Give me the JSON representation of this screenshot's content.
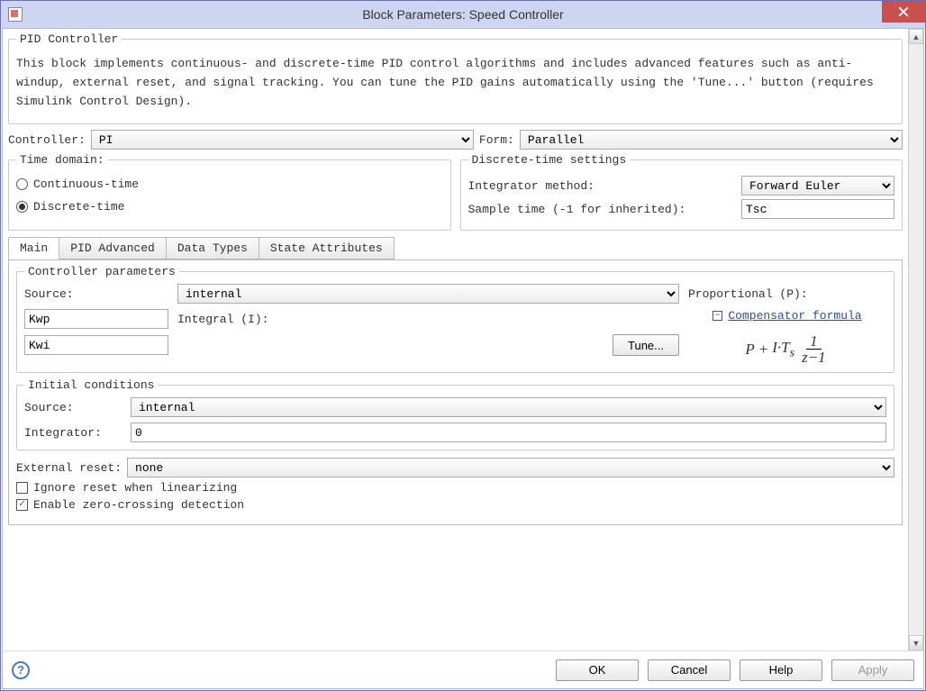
{
  "window": {
    "title": "Block Parameters: Speed Controller"
  },
  "pid_group": {
    "legend": "PID Controller",
    "description": "This block implements continuous- and discrete-time PID control algorithms and includes advanced features such as anti-windup, external reset, and signal tracking. You can tune the PID gains automatically using the 'Tune...' button (requires Simulink Control Design)."
  },
  "controller_row": {
    "label": "Controller:",
    "value": "PI"
  },
  "form_row": {
    "label": "Form:",
    "value": "Parallel"
  },
  "time_domain": {
    "legend": "Time domain:",
    "options": {
      "continuous": "Continuous-time",
      "discrete": "Discrete-time"
    },
    "selected": "discrete"
  },
  "discrete_settings": {
    "legend": "Discrete-time settings",
    "integrator_label": "Integrator method:",
    "integrator_value": "Forward Euler",
    "sample_label": "Sample time (-1 for inherited):",
    "sample_value": "Tsc"
  },
  "tabs": {
    "main": "Main",
    "pid_adv": "PID Advanced",
    "data_types": "Data Types",
    "state_attrs": "State Attributes"
  },
  "controller_params": {
    "legend": "Controller parameters",
    "source_label": "Source:",
    "source_value": "internal",
    "p_label": "Proportional (P):",
    "p_value": "Kwp",
    "i_label": "Integral (I):",
    "i_value": "Kwi",
    "tune_label": "Tune...",
    "comp_link": "Compensator formula"
  },
  "initial_conditions": {
    "legend": "Initial conditions",
    "source_label": "Source:",
    "source_value": "internal",
    "integrator_label": "Integrator:",
    "integrator_value": "0"
  },
  "external_reset": {
    "label": "External reset:",
    "value": "none"
  },
  "checkboxes": {
    "ignore_reset": {
      "label": "Ignore reset when linearizing",
      "checked": false
    },
    "zero_cross": {
      "label": "Enable zero-crossing detection",
      "checked": true
    }
  },
  "footer": {
    "ok": "OK",
    "cancel": "Cancel",
    "help": "Help",
    "apply": "Apply"
  }
}
